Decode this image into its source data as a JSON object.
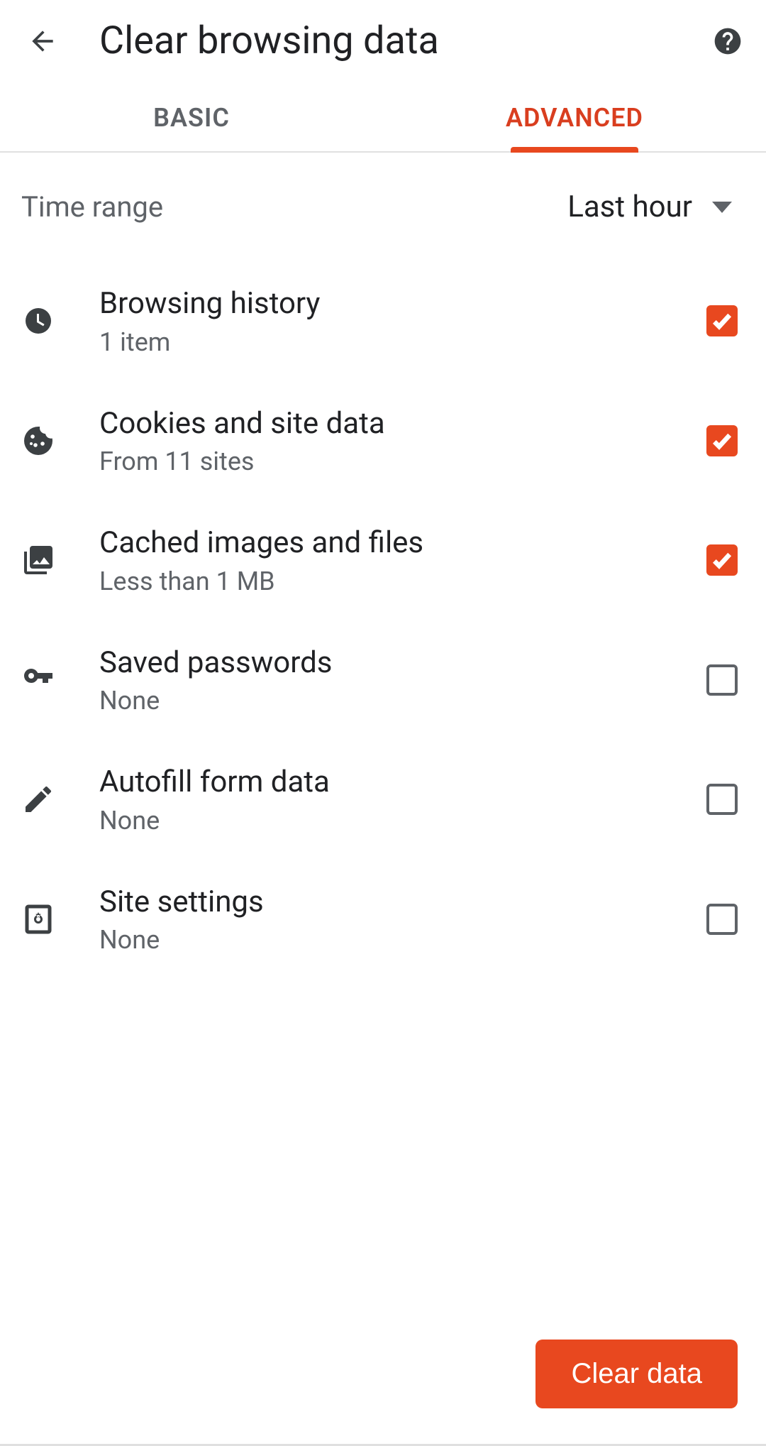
{
  "header": {
    "title": "Clear browsing data"
  },
  "tabs": {
    "basic": "BASIC",
    "advanced": "ADVANCED",
    "active": "advanced"
  },
  "timeRange": {
    "label": "Time range",
    "value": "Last hour"
  },
  "items": [
    {
      "icon": "history-icon",
      "title": "Browsing history",
      "subtitle": "1 item",
      "checked": true
    },
    {
      "icon": "cookie-icon",
      "title": "Cookies and site data",
      "subtitle": "From 11 sites",
      "checked": true
    },
    {
      "icon": "image-files-icon",
      "title": "Cached images and files",
      "subtitle": "Less than 1 MB",
      "checked": true
    },
    {
      "icon": "key-icon",
      "title": "Saved passwords",
      "subtitle": "None",
      "checked": false
    },
    {
      "icon": "pencil-icon",
      "title": "Autofill form data",
      "subtitle": "None",
      "checked": false
    },
    {
      "icon": "site-settings-icon",
      "title": "Site settings",
      "subtitle": "None",
      "checked": false
    }
  ],
  "footer": {
    "clearButton": "Clear data"
  }
}
